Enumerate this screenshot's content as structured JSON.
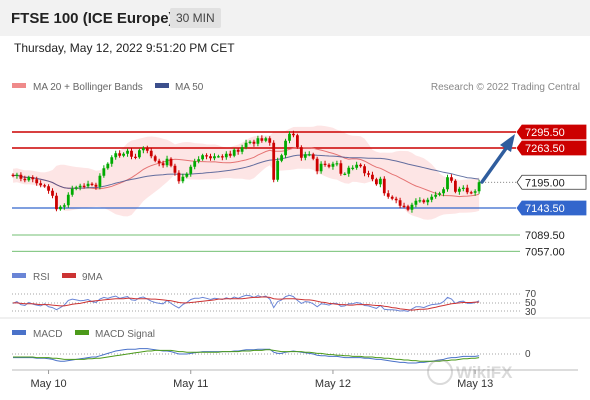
{
  "header": {
    "title": "FTSE 100 (ICE Europe)",
    "timeframe": "30 MIN"
  },
  "timestamp": "Thursday, May 12, 2022 9:51:20 PM CET",
  "credit": "Research © 2022 Trading Central",
  "watermark": "WikiFX",
  "colors": {
    "resistance": "#cc0000",
    "support": "#3366cc",
    "targets": "#44aa44",
    "bands": "#fde0e0",
    "ma20": "#e57373",
    "ma50": "#3c4f8c",
    "candle_up": "#00aa00",
    "candle_down": "#cc0000",
    "rsi": "#6a85d6",
    "signal": "#cc3333",
    "macd": "#4a72c9",
    "macd_signal": "#4c9a1a",
    "arrow": "#2f5d9e"
  },
  "chart_data": [
    {
      "type": "candlestick",
      "legend": [
        "MA 20 + Bollinger Bands",
        "MA 50"
      ],
      "ylim": [
        7040,
        7320
      ],
      "x_ticks": [
        "May 10",
        "May 11",
        "May 12",
        "May 13"
      ],
      "levels": [
        {
          "label": "7295.50",
          "value": 7295.5,
          "kind": "resistance"
        },
        {
          "label": "7263.50",
          "value": 7263.5,
          "kind": "resistance"
        },
        {
          "label": "7195.00",
          "value": 7195.0,
          "kind": "last"
        },
        {
          "label": "7143.50",
          "value": 7143.5,
          "kind": "support"
        },
        {
          "label": "7089.50",
          "value": 7089.5,
          "kind": "target"
        },
        {
          "label": "7057.00",
          "value": 7057.0,
          "kind": "target"
        }
      ],
      "close": [
        7208,
        7210,
        7202,
        7199,
        7205,
        7201,
        7193,
        7189,
        7187,
        7178,
        7168,
        7141,
        7146,
        7149,
        7170,
        7182,
        7185,
        7188,
        7187,
        7192,
        7190,
        7186,
        7208,
        7223,
        7232,
        7245,
        7253,
        7248,
        7252,
        7258,
        7246,
        7245,
        7259,
        7263,
        7258,
        7247,
        7238,
        7233,
        7229,
        7242,
        7228,
        7214,
        7197,
        7206,
        7212,
        7226,
        7237,
        7241,
        7249,
        7247,
        7243,
        7247,
        7247,
        7245,
        7252,
        7248,
        7260,
        7256,
        7265,
        7274,
        7276,
        7272,
        7283,
        7278,
        7283,
        7274,
        7200,
        7238,
        7249,
        7278,
        7292,
        7289,
        7265,
        7244,
        7251,
        7251,
        7242,
        7217,
        7232,
        7230,
        7226,
        7232,
        7233,
        7212,
        7212,
        7224,
        7224,
        7230,
        7227,
        7213,
        7210,
        7201,
        7191,
        7202,
        7173,
        7166,
        7162,
        7159,
        7148,
        7147,
        7140,
        7150,
        7158,
        7159,
        7155,
        7160,
        7166,
        7170,
        7173,
        7181,
        7205,
        7198,
        7176,
        7182,
        7184,
        7175,
        7174,
        7177,
        7195
      ]
    },
    {
      "type": "line",
      "legend": [
        "RSI",
        "9MA"
      ],
      "levels": [
        "70",
        "50",
        "30"
      ],
      "series": [
        {
          "name": "RSI",
          "values": [
            48,
            52,
            45,
            43,
            50,
            46,
            44,
            42,
            47,
            40,
            38,
            33,
            38,
            44,
            55,
            58,
            56,
            54,
            55,
            57,
            52,
            50,
            58,
            62,
            60,
            63,
            65,
            60,
            62,
            64,
            56,
            55,
            61,
            63,
            58,
            53,
            50,
            48,
            47,
            55,
            48,
            42,
            37,
            45,
            50,
            57,
            60,
            60,
            62,
            60,
            57,
            60,
            59,
            57,
            61,
            58,
            63,
            60,
            64,
            67,
            66,
            62,
            66,
            63,
            65,
            58,
            38,
            52,
            56,
            64,
            67,
            64,
            55,
            48,
            52,
            51,
            47,
            40,
            47,
            46,
            44,
            48,
            48,
            41,
            42,
            47,
            47,
            50,
            48,
            43,
            42,
            39,
            36,
            43,
            34,
            33,
            33,
            32,
            30,
            31,
            29,
            35,
            40,
            40,
            38,
            42,
            45,
            46,
            47,
            52,
            62,
            58,
            48,
            52,
            53,
            48,
            48,
            50,
            54
          ]
        },
        {
          "name": "9MA",
          "values": [
            49,
            49,
            48,
            47,
            47,
            47,
            46,
            45,
            45,
            45,
            44,
            43,
            42,
            42,
            44,
            46,
            47,
            48,
            50,
            52,
            53,
            54,
            55,
            56,
            57,
            58,
            59,
            59,
            59,
            60,
            60,
            59,
            59,
            59,
            59,
            58,
            58,
            57,
            56,
            55,
            54,
            52,
            50,
            49,
            49,
            50,
            51,
            52,
            53,
            54,
            55,
            56,
            58,
            58,
            59,
            59,
            59,
            59,
            59,
            60,
            61,
            62,
            62,
            63,
            63,
            62,
            59,
            58,
            58,
            59,
            59,
            59,
            58,
            57,
            56,
            56,
            55,
            53,
            51,
            50,
            48,
            47,
            46,
            45,
            45,
            44,
            44,
            45,
            45,
            45,
            45,
            44,
            43,
            43,
            41,
            40,
            38,
            37,
            35,
            34,
            33,
            32,
            33,
            34,
            34,
            35,
            37,
            39,
            41,
            43,
            45,
            47,
            48,
            49,
            50,
            50,
            50,
            51,
            51
          ]
        }
      ]
    },
    {
      "type": "line",
      "legend": [
        "MACD",
        "MACD Signal"
      ],
      "zero_label": "0",
      "series": [
        {
          "name": "MACD",
          "values": [
            -6,
            -6,
            -6,
            -6,
            -6,
            -6,
            -7,
            -7,
            -7,
            -8,
            -9,
            -11,
            -12,
            -12,
            -11,
            -10,
            -9,
            -8,
            -7,
            -6,
            -5,
            -5,
            -3,
            -1,
            1,
            3,
            5,
            6,
            7,
            8,
            8,
            8,
            9,
            9,
            9,
            8,
            7,
            6,
            5,
            5,
            4,
            2,
            0,
            0,
            0,
            1,
            2,
            3,
            4,
            4,
            4,
            4,
            4,
            4,
            4,
            4,
            5,
            5,
            6,
            7,
            7,
            7,
            8,
            8,
            8,
            8,
            3,
            1,
            1,
            3,
            4,
            5,
            4,
            3,
            2,
            1,
            0,
            -2,
            -3,
            -3,
            -4,
            -4,
            -4,
            -5,
            -6,
            -6,
            -6,
            -6,
            -6,
            -7,
            -7,
            -8,
            -9,
            -9,
            -10,
            -11,
            -12,
            -13,
            -14,
            -14,
            -15,
            -15,
            -15,
            -14,
            -14,
            -13,
            -12,
            -11,
            -10,
            -9,
            -7,
            -6,
            -6,
            -5,
            -4,
            -4,
            -4,
            -4,
            -3
          ]
        },
        {
          "name": "MACD Signal",
          "values": [
            -5,
            -5,
            -5,
            -5,
            -5,
            -5,
            -6,
            -6,
            -6,
            -6,
            -7,
            -7,
            -8,
            -9,
            -9,
            -9,
            -9,
            -9,
            -9,
            -8,
            -8,
            -7,
            -7,
            -6,
            -5,
            -4,
            -3,
            -2,
            -1,
            0,
            1,
            2,
            3,
            4,
            5,
            5,
            6,
            6,
            6,
            6,
            6,
            5,
            4,
            4,
            3,
            3,
            3,
            3,
            3,
            3,
            3,
            3,
            3,
            4,
            4,
            4,
            4,
            4,
            5,
            5,
            5,
            6,
            6,
            6,
            7,
            7,
            6,
            5,
            4,
            4,
            4,
            4,
            4,
            4,
            3,
            3,
            2,
            1,
            1,
            0,
            -1,
            -1,
            -2,
            -2,
            -3,
            -3,
            -4,
            -4,
            -4,
            -5,
            -5,
            -5,
            -6,
            -6,
            -7,
            -7,
            -8,
            -9,
            -9,
            -10,
            -10,
            -11,
            -11,
            -12,
            -12,
            -12,
            -12,
            -12,
            -12,
            -11,
            -11,
            -10,
            -10,
            -9,
            -8,
            -8,
            -7,
            -7,
            -6
          ]
        }
      ]
    }
  ]
}
